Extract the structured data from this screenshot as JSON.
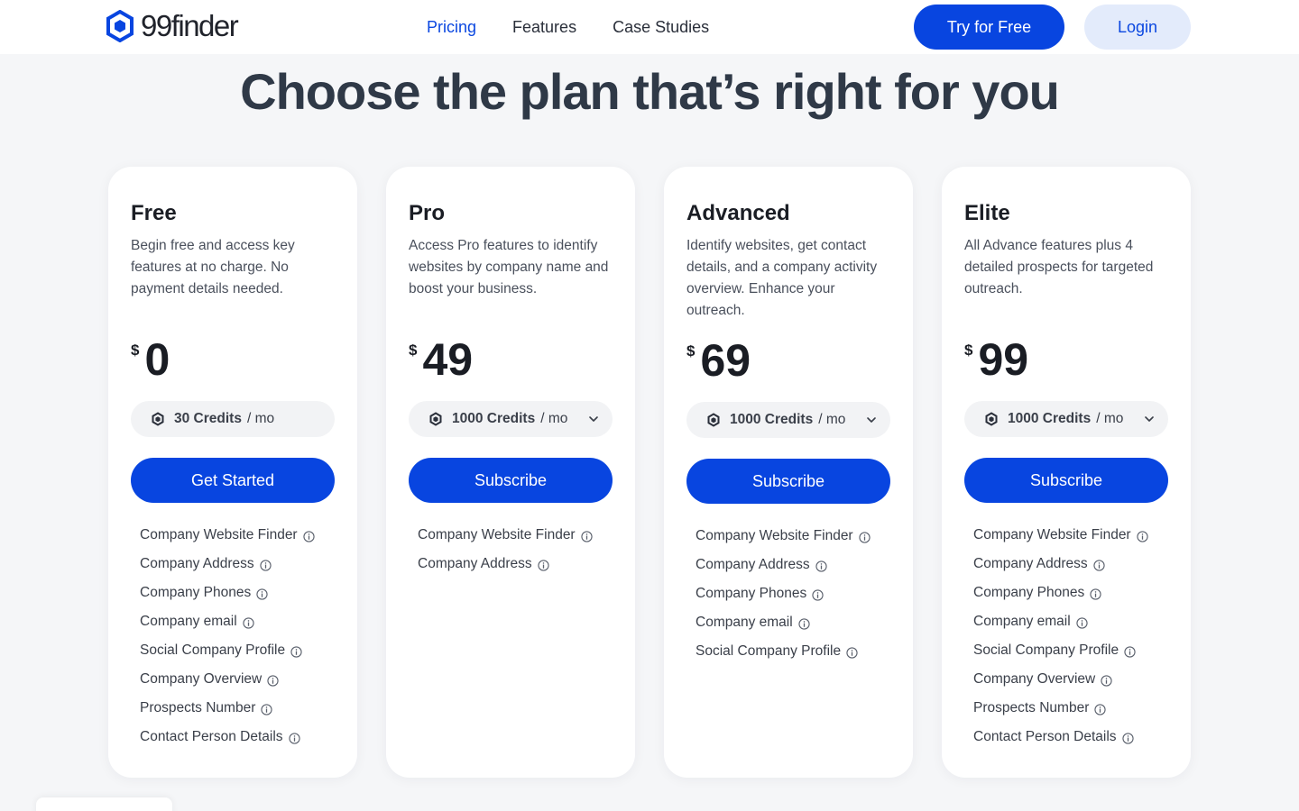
{
  "header": {
    "logo_text": "99finder",
    "nav": [
      {
        "label": "Pricing",
        "active": true
      },
      {
        "label": "Features",
        "active": false
      },
      {
        "label": "Case Studies",
        "active": false
      }
    ],
    "try_label": "Try for Free",
    "login_label": "Login"
  },
  "hero": {
    "title": "Choose the plan that’s right for you"
  },
  "colors": {
    "accent": "#0845e0",
    "login_bg": "#e3ebfb",
    "page_bg": "#f5f6f8"
  },
  "plans": [
    {
      "name": "Free",
      "description": "Begin free and access key features at no charge. No payment details needed.",
      "currency": "$",
      "price": "0",
      "credits": "30 Credits",
      "per": "/ mo",
      "has_dropdown": false,
      "button_label": "Get Started",
      "features": [
        "Company Website Finder",
        "Company Address",
        "Company Phones",
        "Company email",
        "Social Company Profile",
        "Company Overview",
        "Prospects Number",
        "Contact Person Details"
      ]
    },
    {
      "name": "Pro",
      "description": "Access Pro features to identify websites by company name and boost your business.",
      "currency": "$",
      "price": "49",
      "credits": "1000 Credits",
      "per": "/ mo",
      "has_dropdown": true,
      "button_label": "Subscribe",
      "features": [
        "Company Website Finder",
        "Company Address"
      ]
    },
    {
      "name": "Advanced",
      "description": "Identify websites, get contact details, and a company activity overview. Enhance your outreach.",
      "currency": "$",
      "price": "69",
      "credits": "1000 Credits",
      "per": "/ mo",
      "has_dropdown": true,
      "button_label": "Subscribe",
      "features": [
        "Company Website Finder",
        "Company Address",
        "Company Phones",
        "Company email",
        "Social Company Profile"
      ]
    },
    {
      "name": "Elite",
      "description": "All Advance features plus 4 detailed prospects for targeted outreach.",
      "currency": "$",
      "price": "99",
      "credits": "1000 Credits",
      "per": "/ mo",
      "has_dropdown": true,
      "button_label": "Subscribe",
      "features": [
        "Company Website Finder",
        "Company Address",
        "Company Phones",
        "Company email",
        "Social Company Profile",
        "Company Overview",
        "Prospects Number",
        "Contact Person Details"
      ]
    }
  ]
}
